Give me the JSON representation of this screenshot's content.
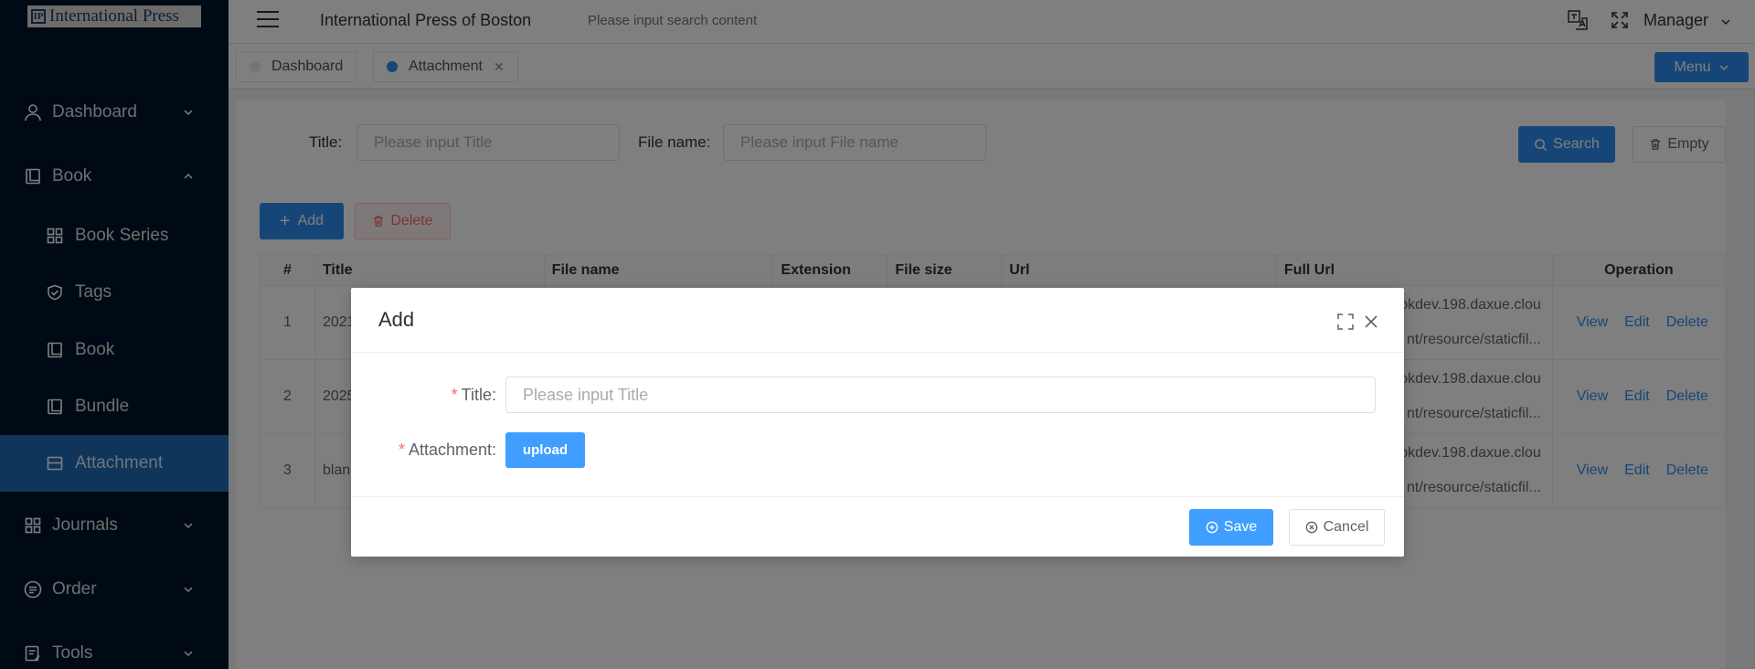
{
  "logo": {
    "mark": "IP",
    "text": "International Press"
  },
  "sidebar": {
    "items": [
      {
        "label": "Dashboard",
        "icon": "user-icon",
        "level": 0,
        "expanded": false
      },
      {
        "label": "Book",
        "icon": "book-icon",
        "level": 0,
        "expanded": true
      },
      {
        "label": "Book Series",
        "icon": "grid-icon",
        "level": 1
      },
      {
        "label": "Tags",
        "icon": "shield-check-icon",
        "level": 1
      },
      {
        "label": "Book",
        "icon": "book-icon",
        "level": 1
      },
      {
        "label": "Bundle",
        "icon": "book-icon",
        "level": 1
      },
      {
        "label": "Attachment",
        "icon": "credit-card-icon",
        "level": 1,
        "active": true
      },
      {
        "label": "Journals",
        "icon": "grid-icon",
        "level": 0,
        "expanded": false
      },
      {
        "label": "Order",
        "icon": "list-circle-icon",
        "level": 0,
        "expanded": false
      },
      {
        "label": "Tools",
        "icon": "edit-list-icon",
        "level": 0,
        "expanded": false
      }
    ]
  },
  "header": {
    "title": "International Press of Boston",
    "search_placeholder": "Please input search content",
    "user": "Manager"
  },
  "tabs": [
    {
      "label": "Dashboard",
      "active": false
    },
    {
      "label": "Attachment",
      "active": true,
      "closable": true
    }
  ],
  "menu_button": "Menu",
  "filters": {
    "title_label": "Title:",
    "title_placeholder": "Please input Title",
    "filename_label": "File name:",
    "filename_placeholder": "Please input File name",
    "search": "Search",
    "empty": "Empty"
  },
  "toolbar": {
    "add": "Add",
    "delete": "Delete"
  },
  "table": {
    "columns": [
      "#",
      "Title",
      "File name",
      "Extension",
      "File size",
      "Url",
      "Full Url",
      "Operation"
    ],
    "rows": [
      {
        "index": "1",
        "title": "2021",
        "full_url_1": "okdev.198.daxue.clou",
        "full_url_2": "nt/resource/staticfil..."
      },
      {
        "index": "2",
        "title": "2025",
        "full_url_1": "okdev.198.daxue.clou",
        "full_url_2": "nt/resource/staticfil..."
      },
      {
        "index": "3",
        "title": "blan",
        "full_url_1": "okdev.198.daxue.clou",
        "full_url_2": "nt/resource/staticfil..."
      }
    ],
    "ops": {
      "view": "View",
      "edit": "Edit",
      "delete": "Delete"
    }
  },
  "modal": {
    "title": "Add",
    "title_label": "Title:",
    "title_placeholder": "Please input Title",
    "attachment_label": "Attachment:",
    "upload": "upload",
    "save": "Save",
    "cancel": "Cancel",
    "required_mark": "*"
  },
  "colors": {
    "sidebar_bg": "#001529",
    "active_item": "#1f6bb7",
    "primary": "#2d8cf0",
    "modal_primary": "#409eff",
    "danger": "#f56c6c"
  }
}
